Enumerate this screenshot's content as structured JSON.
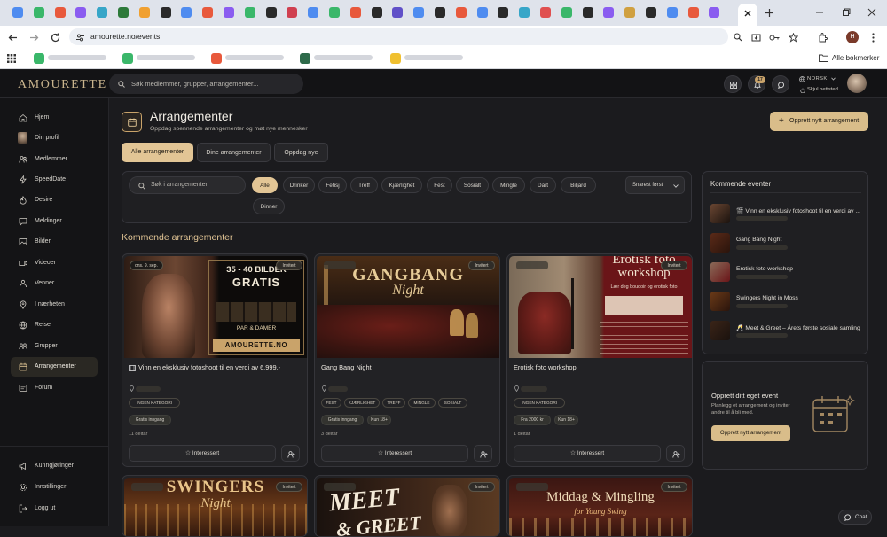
{
  "browser": {
    "url": "amourette.no/events",
    "bookmarks_all_label": "Alle bokmerker",
    "tab_favicon_colors": [
      "#4f8cf0",
      "#3ab76a",
      "#e8593c",
      "#8a5cf0",
      "#37a6c8",
      "#2d7a3a",
      "#f0a030",
      "#2a2a2a",
      "#4f8cf0",
      "#e8593c",
      "#8a5cf0",
      "#3ab76a",
      "#2a2a2a",
      "#d04050",
      "#4f8cf0",
      "#3ab76a",
      "#e8593c",
      "#2a2a2a",
      "#6050c8",
      "#4f8cf0",
      "#2a2a2a",
      "#e8593c",
      "#4f8cf0",
      "#2a2a2a",
      "#37a6c8",
      "#e05050",
      "#3ab76a",
      "#2a2a2a",
      "#8a5cf0",
      "#d0a040",
      "#2a2a2a",
      "#4f8cf0",
      "#e8593c",
      "#8a5cf0"
    ],
    "bookmark_favicon_colors": [
      "#3ab76a",
      "#3ab76a",
      "#e8593c",
      "#2d6a4a",
      "#f0c030"
    ],
    "profile_initial": "H"
  },
  "header": {
    "logo": "AMOURETTE",
    "search_placeholder": "Søk medlemmer, grupper, arrangementer...",
    "notification_count": "17",
    "language": "NORSK",
    "location_label": "Skjul nettsted"
  },
  "sidebar": {
    "items": [
      {
        "label": "Hjem",
        "icon": "home-icon"
      },
      {
        "label": "Din profil",
        "icon": "avatar-icon"
      },
      {
        "label": "Medlemmer",
        "icon": "users-icon"
      },
      {
        "label": "SpeedDate",
        "icon": "bolt-icon"
      },
      {
        "label": "Desire",
        "icon": "flame-icon"
      },
      {
        "label": "Meldinger",
        "icon": "message-icon"
      },
      {
        "label": "Bilder",
        "icon": "image-icon"
      },
      {
        "label": "Videoer",
        "icon": "video-icon"
      },
      {
        "label": "Venner",
        "icon": "friends-icon"
      },
      {
        "label": "I nærheten",
        "icon": "location-icon"
      },
      {
        "label": "Reise",
        "icon": "globe-icon"
      },
      {
        "label": "Grupper",
        "icon": "groups-icon"
      },
      {
        "label": "Arrangementer",
        "icon": "calendar-icon"
      },
      {
        "label": "Forum",
        "icon": "forum-icon"
      }
    ],
    "bottom_items": [
      {
        "label": "Kunngjøringer",
        "icon": "megaphone-icon"
      },
      {
        "label": "Innstillinger",
        "icon": "settings-icon"
      },
      {
        "label": "Logg ut",
        "icon": "logout-icon"
      }
    ]
  },
  "page": {
    "title": "Arrangementer",
    "subtitle": "Oppdag spennende arrangementer og møt nye mennesker",
    "create_button": "Opprett nytt arrangement",
    "tabs": [
      "Alle arrangementer",
      "Dine arrangementer",
      "Oppdag nye"
    ],
    "search_placeholder": "Søk i arrangementer",
    "filters": [
      "Alle",
      "Drinker",
      "Fetisj",
      "Treff",
      "Kjærlighet",
      "Fest",
      "Sosialt",
      "Mingle",
      "Dart",
      "Biljard",
      "Dinner"
    ],
    "sort_label": "Snarest først",
    "section_title": "Kommende arrangementer"
  },
  "events": [
    {
      "date_badge": "ons. 9. sep.",
      "status": "Invitert",
      "title": "Vinn en eksklusiv fotoshoot til en verdi av 6.999,-",
      "title_icon": "film-icon",
      "tags": [
        "INGEN KATEGORI"
      ],
      "info": [
        "Gratis inngang"
      ],
      "attendees": "11 deltar",
      "interest_button": "Interessert",
      "image_caption_top": "35 - 40 BILDER",
      "image_caption_mid": "GRATIS",
      "image_caption_pair": "PAR & DAMER",
      "image_caption_site": "AMOURETTE.NO"
    },
    {
      "status": "Invitert",
      "title": "Gang Bang Night",
      "tags": [
        "FEST",
        "KJÆRLIGHET",
        "TREFF",
        "MINGLE",
        "SOSIALT"
      ],
      "info": [
        "Gratis inngang",
        "Kun 18+"
      ],
      "attendees": "3 deltar",
      "interest_button": "Interessert",
      "image_caption_top": "GANGBANG",
      "image_caption_mid": "Night"
    },
    {
      "status": "Invitert",
      "title": "Erotisk foto workshop",
      "tags": [
        "INGEN KATEGORI"
      ],
      "info": [
        "Fra 2000 kr",
        "Kun 18+"
      ],
      "attendees": "1 deltar",
      "interest_button": "Interessert",
      "image_caption_top": "Erotisk foto",
      "image_caption_mid": "workshop",
      "image_caption_sub": "Lær deg boudoir og erotisk foto"
    }
  ],
  "events_row2": [
    {
      "status": "Invitert",
      "image_caption_top": "SWINGERS",
      "image_caption_mid": "Night"
    },
    {
      "status": "Invitert",
      "image_caption_top": "MEET",
      "image_caption_mid": "& GREET"
    },
    {
      "status": "Invitert",
      "image_caption_top": "Middag & Mingling",
      "image_caption_mid": "for Young Swing"
    }
  ],
  "upcoming": {
    "title": "Kommende eventer",
    "items": [
      {
        "label": "Vinn en eksklusiv fotoshoot til en verdi av ...",
        "prefix": "🎬"
      },
      {
        "label": "Gang Bang Night",
        "prefix": ""
      },
      {
        "label": "Erotisk foto workshop",
        "prefix": ""
      },
      {
        "label": "Swingers Night in Moss",
        "prefix": ""
      },
      {
        "label": "Meet & Greet – Årets første sosiale samling",
        "prefix": "🥂"
      }
    ]
  },
  "create_panel": {
    "title": "Opprett ditt eget event",
    "text": "Planlegg et arrangement og inviter andre til å bli med.",
    "button": "Opprett nytt arrangement"
  },
  "chat_button": "Chat",
  "colors": {
    "accent": "#d9bd8a",
    "bg": "#1b1b1e",
    "card": "#222225"
  }
}
